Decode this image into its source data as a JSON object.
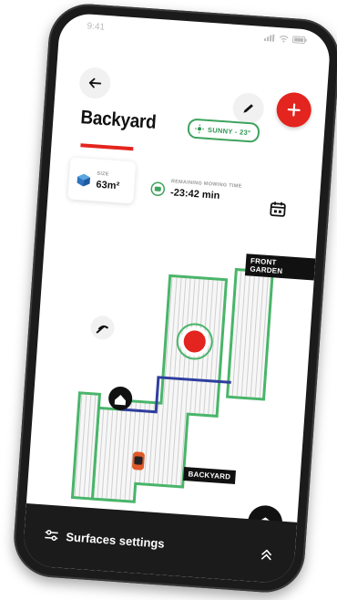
{
  "status_bar": {
    "time": "9:41"
  },
  "header": {
    "title": "Backyard",
    "weather": "SUNNY - 23°"
  },
  "info": {
    "size": {
      "label": "SIZE",
      "value": "63m²"
    },
    "remaining": {
      "label": "REMAINING MOWING TIME",
      "value": "-23:42 min"
    }
  },
  "map": {
    "front_label": "FRONT GARDEN",
    "back_label": "BACKYARD"
  },
  "bottom": {
    "surfaces_label": "Surfaces settings"
  },
  "colors": {
    "accent": "#e4241e",
    "lawn_border": "#49b56a",
    "path": "#2f3e9e",
    "dark": "#1b1b1c"
  },
  "icons": [
    "back-arrow-icon",
    "pencil-icon",
    "plus-icon",
    "sun-icon",
    "cube-icon",
    "mower-icon",
    "calendar-icon",
    "signal-icon",
    "home-icon",
    "layers-icon",
    "sliders-icon",
    "chevron-up-icon"
  ]
}
